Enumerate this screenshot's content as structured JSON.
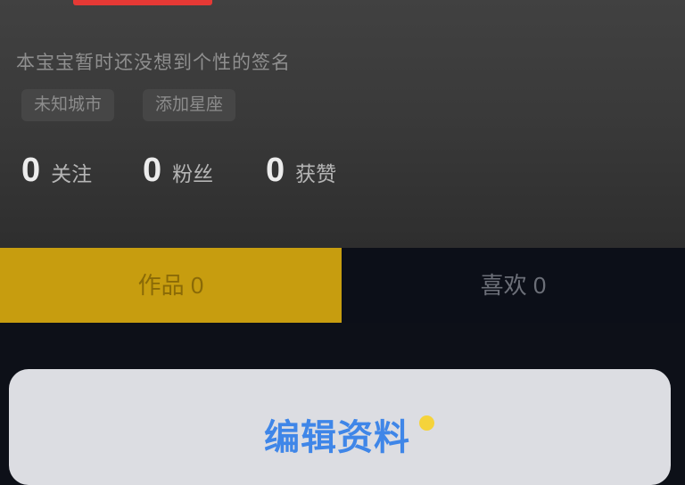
{
  "profile": {
    "bio": "本宝宝暂时还没想到个性的签名",
    "tags": [
      "未知城市",
      "添加星座"
    ],
    "stats": [
      {
        "value": "0",
        "label": "关注"
      },
      {
        "value": "0",
        "label": "粉丝"
      },
      {
        "value": "0",
        "label": "获赞"
      }
    ]
  },
  "tabs": [
    {
      "label": "作品 0",
      "active": true
    },
    {
      "label": "喜欢 0",
      "active": false
    }
  ],
  "edit_card": {
    "label": "编辑资料"
  },
  "colors": {
    "accent": "#c79d0f",
    "badge_red": "#e53935",
    "link_blue": "#3f86e8",
    "dot_yellow": "#f5d33b"
  }
}
